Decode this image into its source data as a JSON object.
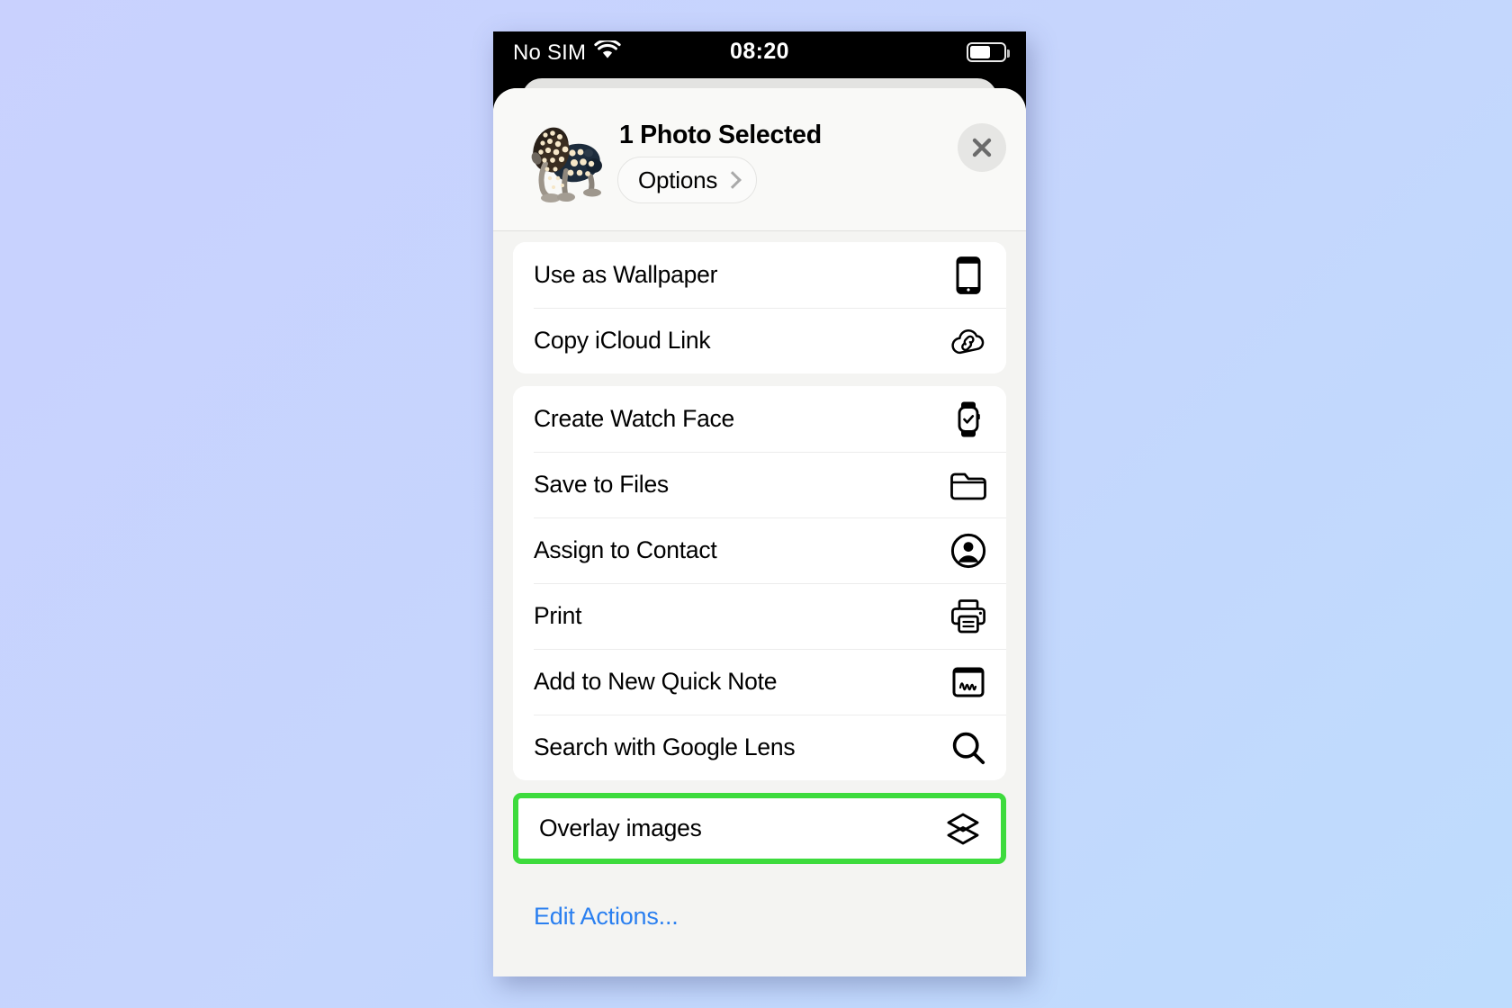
{
  "status_bar": {
    "carrier": "No SIM",
    "wifi_icon": "wifi-icon",
    "time": "08:20",
    "battery_icon": "battery-icon",
    "battery_level_pct": 55
  },
  "share_sheet": {
    "title": "1 Photo Selected",
    "thumbnail_alt": "Spotted frog sculpture photo",
    "options_button": {
      "label": "Options",
      "chevron": "chevron-right-icon"
    },
    "close_button": {
      "icon": "close-icon"
    },
    "groups": [
      {
        "rows": [
          {
            "label": "Use as Wallpaper",
            "icon": "iphone-icon"
          },
          {
            "label": "Copy iCloud Link",
            "icon": "icloud-link-icon"
          }
        ]
      },
      {
        "rows": [
          {
            "label": "Create Watch Face",
            "icon": "apple-watch-icon"
          },
          {
            "label": "Save to Files",
            "icon": "folder-icon"
          },
          {
            "label": "Assign to Contact",
            "icon": "person-circle-icon"
          },
          {
            "label": "Print",
            "icon": "printer-icon"
          },
          {
            "label": "Add to New Quick Note",
            "icon": "quick-note-icon"
          },
          {
            "label": "Search with Google Lens",
            "icon": "search-icon"
          }
        ]
      },
      {
        "highlighted": true,
        "rows": [
          {
            "label": "Overlay images",
            "icon": "layers-icon"
          }
        ]
      }
    ],
    "edit_actions": {
      "label": "Edit Actions..."
    }
  },
  "colors": {
    "background_start": "#c9d1fe",
    "background_end": "#bedcfd",
    "sheet_background": "#f4f4f2",
    "row_background": "#ffffff",
    "highlight": "#3ddb3d",
    "link": "#2a7ff0",
    "status_bar_background": "#000000",
    "status_bar_text": "#ffffff"
  }
}
